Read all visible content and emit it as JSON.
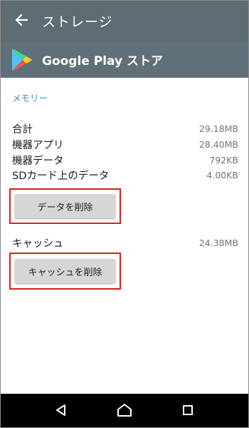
{
  "app_bar": {
    "title": "ストレージ",
    "back_icon": "arrow-back-icon"
  },
  "app_header": {
    "name": "Google Play ストア",
    "logo_icon": "google-play-icon"
  },
  "memory": {
    "section_title": "メモリー",
    "rows": [
      {
        "label": "合計",
        "value": "29.18MB"
      },
      {
        "label": "機器アプリ",
        "value": "28.40MB"
      },
      {
        "label": "機器データ",
        "value": "792KB"
      },
      {
        "label": "SDカード上のデータ",
        "value": "4.00KB"
      }
    ],
    "clear_data_label": "データを削除"
  },
  "cache": {
    "label": "キャッシュ",
    "value": "24.38MB",
    "clear_cache_label": "キャッシュを削除"
  },
  "nav_bar": {
    "back_icon": "nav-back-icon",
    "home_icon": "nav-home-icon",
    "recents_icon": "nav-recents-icon"
  },
  "colors": {
    "app_bar": "#5e6c73",
    "accent": "#3b8fb5",
    "highlight": "#d32121",
    "button": "#d6d6d6"
  }
}
